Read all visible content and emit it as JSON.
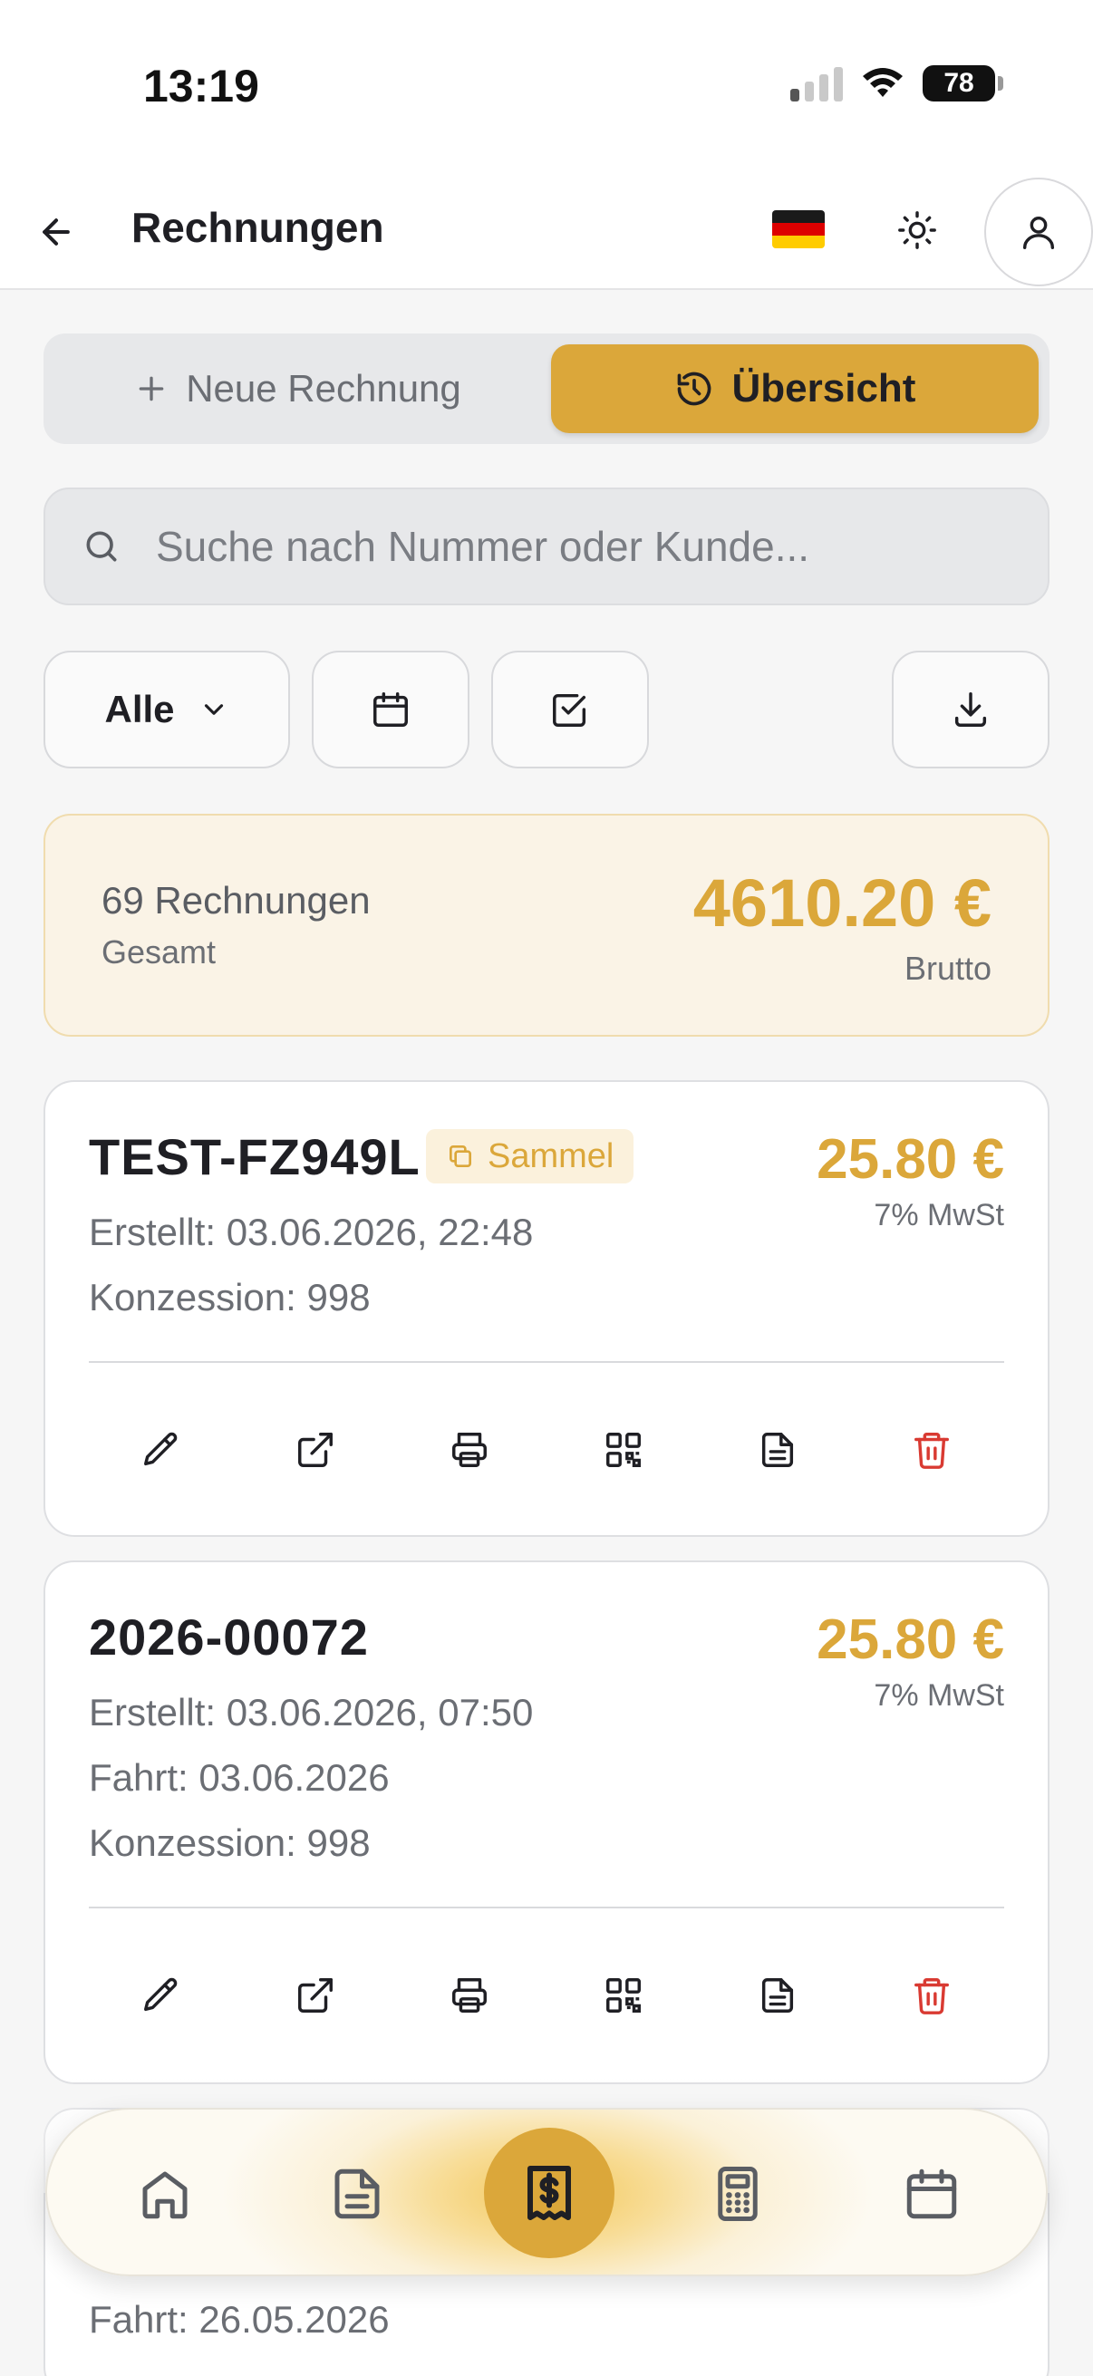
{
  "status_bar": {
    "time": "13:19",
    "battery": "78"
  },
  "header": {
    "title": "Rechnungen"
  },
  "tabs": {
    "new_label": "Neue Rechnung",
    "overview_label": "Übersicht"
  },
  "search": {
    "placeholder": "Suche nach Nummer oder Kunde..."
  },
  "filters": {
    "status_label": "Alle"
  },
  "summary": {
    "count_text": "69 Rechnungen",
    "count_label": "Gesamt",
    "total": "4610.20 €",
    "total_label": "Brutto"
  },
  "invoices": [
    {
      "number": "TEST-FZ949L",
      "tag": "Sammel",
      "amount": "25.80 €",
      "vat": "7% MwSt",
      "created": "Erstellt: 03.06.2026, 22:48",
      "concession": "Konzession: 998"
    },
    {
      "number": "2026-00072",
      "amount": "25.80 €",
      "vat": "7% MwSt",
      "created": "Erstellt: 03.06.2026, 07:50",
      "ride": "Fahrt: 03.06.2026",
      "concession": "Konzession: 998"
    },
    {
      "ride": "Fahrt: 26.05.2026"
    }
  ],
  "colors": {
    "accent": "#dba73a",
    "danger": "#d93a32",
    "text": "#1f1f24",
    "muted": "#6b6e74"
  },
  "icons": {
    "back": "arrow-left-icon",
    "theme": "sun-icon",
    "profile": "user-icon",
    "new": "plus-icon",
    "overview": "history-icon",
    "search": "search-icon",
    "dropdown": "chevron-down-icon",
    "date": "calendar-icon",
    "select": "checkbox-icon",
    "export": "download-icon",
    "edit": "pencil-icon",
    "open": "external-link-icon",
    "print": "printer-icon",
    "qr": "qr-code-icon",
    "document": "file-text-icon",
    "delete": "trash-icon"
  },
  "nav": [
    "home-icon",
    "documents-icon",
    "invoices-icon",
    "calculator-icon",
    "calendar-icon"
  ]
}
